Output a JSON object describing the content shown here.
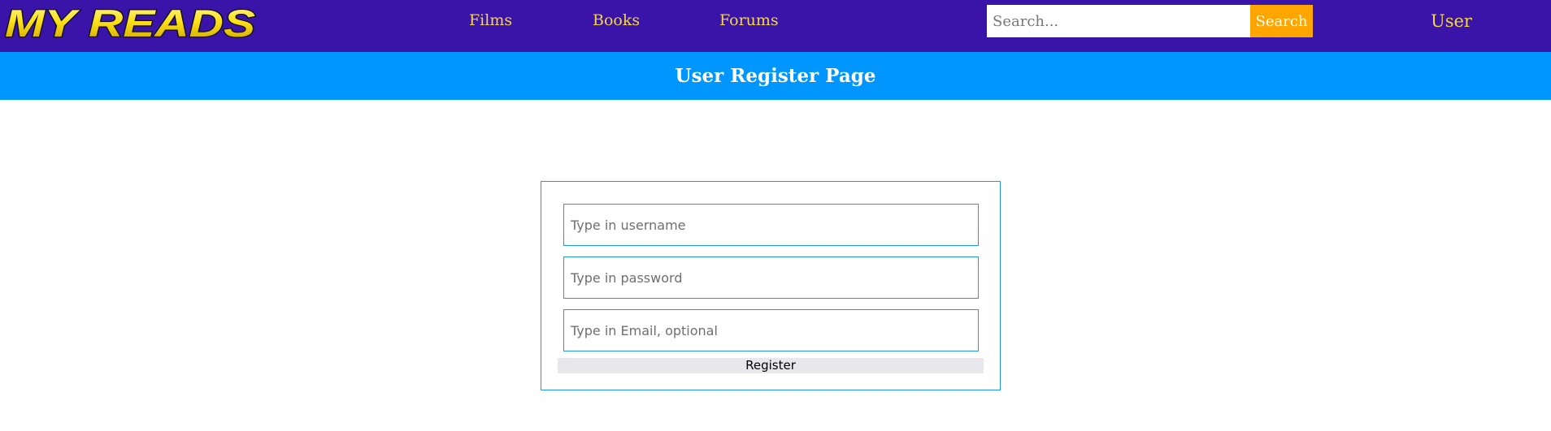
{
  "brand": {
    "logo_text": "MY READS"
  },
  "nav": {
    "items": [
      {
        "label": "Films"
      },
      {
        "label": "Books"
      },
      {
        "label": "Forums"
      }
    ],
    "user_label": "User"
  },
  "search": {
    "placeholder": "Search...",
    "value": "",
    "button_label": "Search"
  },
  "page": {
    "title": "User Register Page"
  },
  "form": {
    "username_placeholder": "Type in username",
    "password_placeholder": "Type in password",
    "email_placeholder": "Type in Email, optional",
    "submit_label": "Register"
  },
  "colors": {
    "navbar_bg": "#3a13a8",
    "nav_link": "#f3d64a",
    "title_bar_bg": "#0096ff",
    "search_button_bg": "#ffa500",
    "form_border": "#1e9be8",
    "logo_fill": "#ffe11a"
  }
}
